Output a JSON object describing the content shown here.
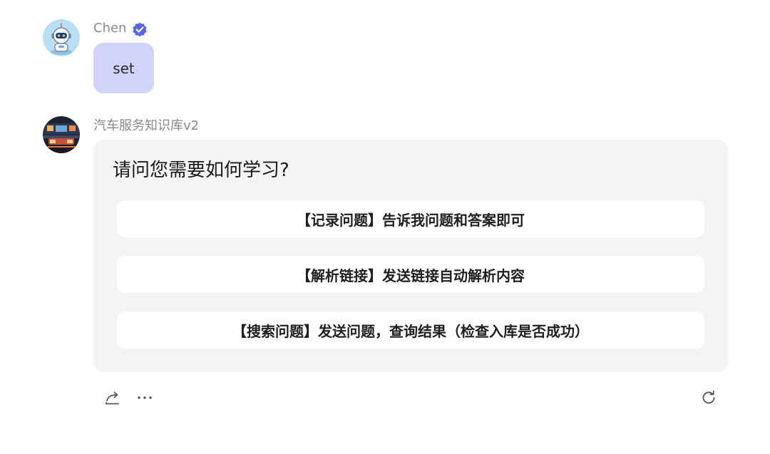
{
  "messages": {
    "user": {
      "name": "Chen",
      "text": "set"
    },
    "bot": {
      "name": "汽车服务知识库v2",
      "question": "请问您需要如何学习?",
      "options": [
        "【记录问题】告诉我问题和答案即可",
        "【解析链接】发送链接自动解析内容",
        "【搜索问题】发送问题，查询结果（检查入库是否成功）"
      ]
    }
  },
  "icons": {
    "user_avatar": "robot-avatar-icon",
    "verified": "verified-badge-icon",
    "bot_avatar": "workshop-avatar-icon",
    "share": "share-icon",
    "more": "more-icon",
    "regenerate": "refresh-icon"
  },
  "colors": {
    "user_bubble": "#d2d3fb",
    "bot_card": "#f4f4f4",
    "verified": "#5b63e6",
    "name_text": "#8a8a8a"
  }
}
